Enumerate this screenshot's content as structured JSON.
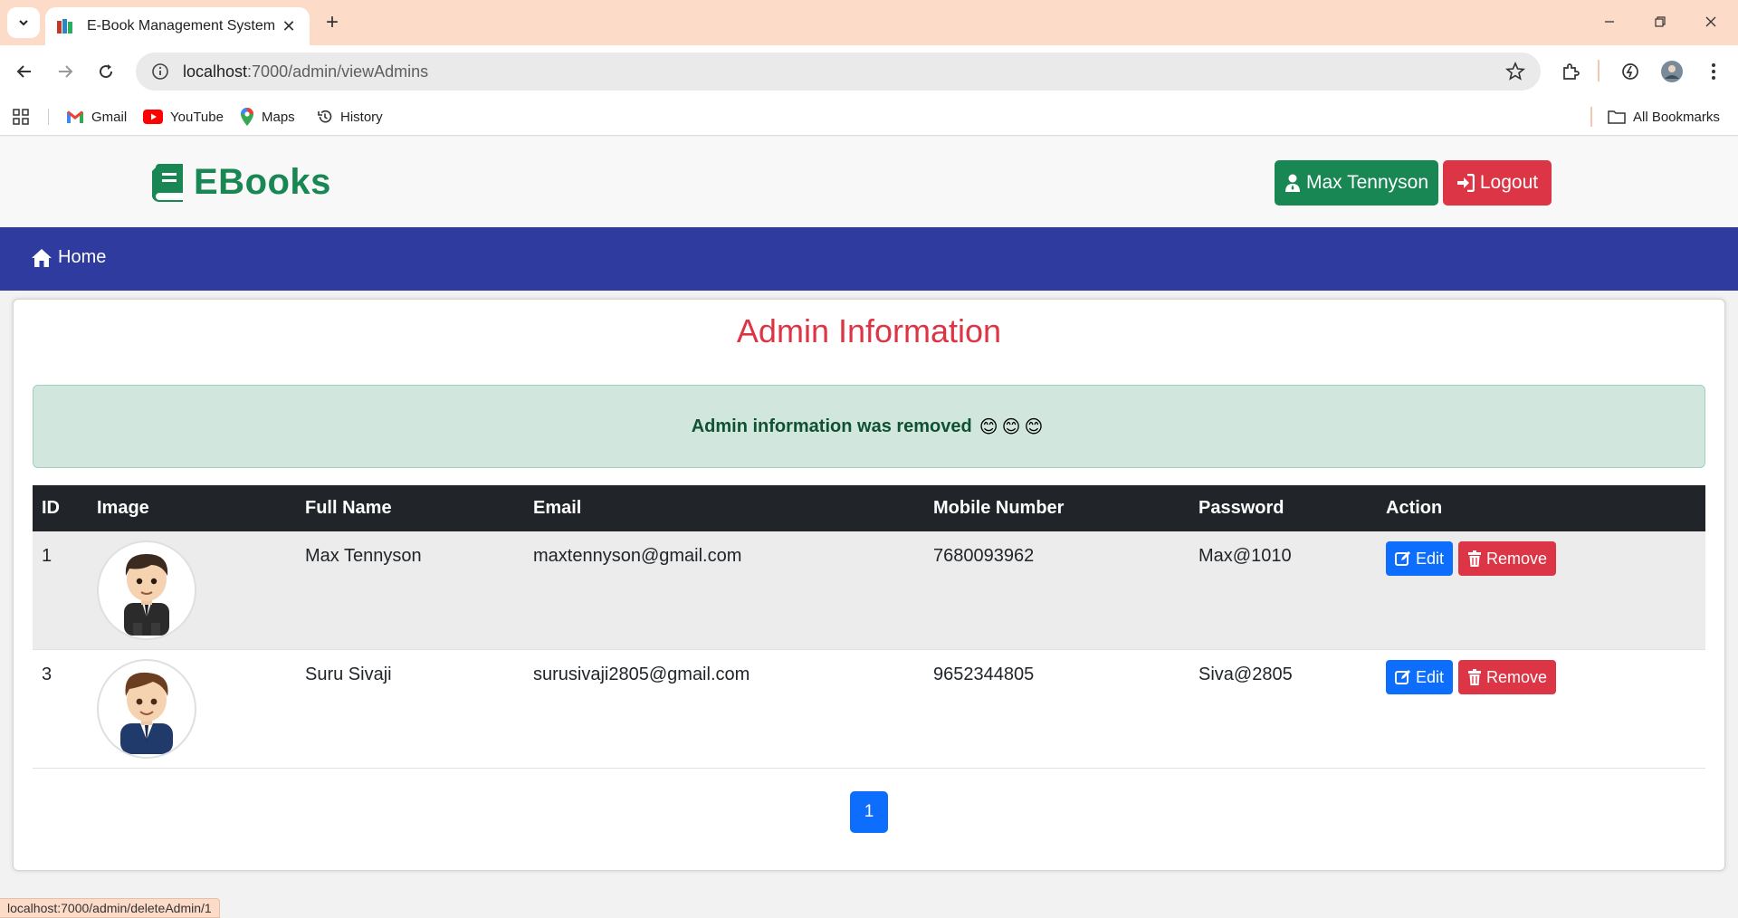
{
  "browser": {
    "tab_title": "E-Book Management System",
    "url_host": "localhost",
    "url_path": ":7000/admin/viewAdmins",
    "bookmarks": [
      {
        "label": "Gmail",
        "icon": "gmail-icon"
      },
      {
        "label": "YouTube",
        "icon": "youtube-icon"
      },
      {
        "label": "Maps",
        "icon": "maps-icon"
      },
      {
        "label": "History",
        "icon": "history-icon"
      }
    ],
    "all_bookmarks": "All Bookmarks",
    "status_url": "localhost:7000/admin/deleteAdmin/1"
  },
  "header": {
    "brand": "EBooks",
    "user_button": "Max Tennyson",
    "logout_button": "Logout"
  },
  "nav": {
    "home": "Home"
  },
  "page": {
    "title": "Admin Information",
    "alert": "Admin information was removed",
    "alert_emoji": "😊😊😊"
  },
  "table": {
    "columns": [
      "ID",
      "Image",
      "Full Name",
      "Email",
      "Mobile Number",
      "Password",
      "Action"
    ],
    "rows": [
      {
        "id": "1",
        "name": "Max Tennyson",
        "email": "maxtennyson@gmail.com",
        "mobile": "7680093962",
        "password": "Max@1010"
      },
      {
        "id": "3",
        "name": "Suru Sivaji",
        "email": "surusivaji2805@gmail.com",
        "mobile": "9652344805",
        "password": "Siva@2805"
      }
    ],
    "edit_label": "Edit",
    "remove_label": "Remove"
  },
  "pagination": {
    "current": "1"
  },
  "colors": {
    "brand_green": "#198754",
    "danger": "#dc3545",
    "primary": "#0d6efd",
    "navbar": "#2f3b9e"
  }
}
